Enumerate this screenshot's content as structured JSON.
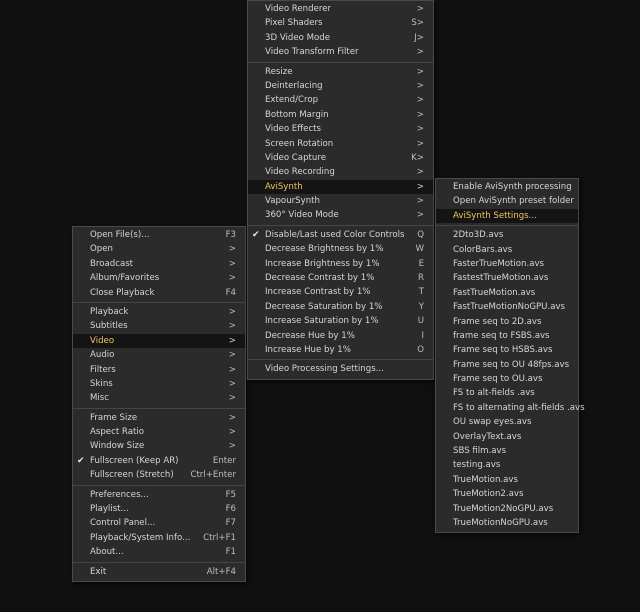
{
  "main_menu": {
    "items_a": [
      {
        "label": "Open File(s)...",
        "key": "F3"
      },
      {
        "label": "Open",
        "key": ">"
      },
      {
        "label": "Broadcast",
        "key": ">"
      },
      {
        "label": "Album/Favorites",
        "key": ">"
      },
      {
        "label": "Close Playback",
        "key": "F4"
      }
    ],
    "items_b": [
      {
        "label": "Playback",
        "key": ">"
      },
      {
        "label": "Subtitles",
        "key": ">"
      },
      {
        "label": "Video",
        "key": ">",
        "active": true
      },
      {
        "label": "Audio",
        "key": ">"
      },
      {
        "label": "Filters",
        "key": ">"
      },
      {
        "label": "Skins",
        "key": ">"
      },
      {
        "label": "Misc",
        "key": ">"
      }
    ],
    "items_c": [
      {
        "label": "Frame Size",
        "key": ">"
      },
      {
        "label": "Aspect Ratio",
        "key": ">"
      },
      {
        "label": "Window Size",
        "key": ">"
      },
      {
        "label": "Fullscreen (Keep AR)",
        "key": "Enter",
        "checked": true
      },
      {
        "label": "Fullscreen (Stretch)",
        "key": "Ctrl+Enter"
      }
    ],
    "items_d": [
      {
        "label": "Preferences...",
        "key": "F5"
      },
      {
        "label": "Playlist...",
        "key": "F6"
      },
      {
        "label": "Control Panel...",
        "key": "F7"
      },
      {
        "label": "Playback/System Info...",
        "key": "Ctrl+F1"
      },
      {
        "label": "About...",
        "key": "F1"
      }
    ],
    "items_e": [
      {
        "label": "Exit",
        "key": "Alt+F4"
      }
    ]
  },
  "video_menu": {
    "items_a": [
      {
        "label": "Video Renderer",
        "key": ">"
      },
      {
        "label": "Pixel Shaders",
        "key": "S>"
      },
      {
        "label": "3D Video Mode",
        "key": "J>"
      },
      {
        "label": "Video Transform Filter",
        "key": ">"
      }
    ],
    "items_b": [
      {
        "label": "Resize",
        "key": ">"
      },
      {
        "label": "Deinterlacing",
        "key": ">"
      },
      {
        "label": "Extend/Crop",
        "key": ">"
      },
      {
        "label": "Bottom Margin",
        "key": ">"
      },
      {
        "label": "Video Effects",
        "key": ">"
      },
      {
        "label": "Screen Rotation",
        "key": ">"
      },
      {
        "label": "Video Capture",
        "key": "K>"
      },
      {
        "label": "Video Recording",
        "key": ">"
      },
      {
        "label": "AviSynth",
        "key": ">",
        "active": true
      },
      {
        "label": "VapourSynth",
        "key": ">"
      },
      {
        "label": "360° Video Mode",
        "key": ">"
      }
    ],
    "items_c": [
      {
        "label": "Disable/Last used Color Controls",
        "key": "Q",
        "checked": true
      },
      {
        "label": "Decrease Brightness by 1%",
        "key": "W"
      },
      {
        "label": "Increase Brightness by 1%",
        "key": "E"
      },
      {
        "label": "Decrease Contrast by 1%",
        "key": "R"
      },
      {
        "label": "Increase Contrast by 1%",
        "key": "T"
      },
      {
        "label": "Decrease Saturation by 1%",
        "key": "Y"
      },
      {
        "label": "Increase Saturation by 1%",
        "key": "U"
      },
      {
        "label": "Decrease Hue by 1%",
        "key": "I"
      },
      {
        "label": "Increase Hue by 1%",
        "key": "O"
      }
    ],
    "items_d": [
      {
        "label": "Video Processing Settings...",
        "key": ""
      }
    ]
  },
  "avisynth_menu": {
    "items_a": [
      {
        "label": "Enable AviSynth processing",
        "key": ""
      },
      {
        "label": "Open AviSynth preset folder",
        "key": ""
      },
      {
        "label": "AviSynth Settings...",
        "key": "",
        "active": true
      }
    ],
    "items_b": [
      {
        "label": "2Dto3D.avs",
        "key": ""
      },
      {
        "label": "ColorBars.avs",
        "key": ""
      },
      {
        "label": "FasterTrueMotion.avs",
        "key": ""
      },
      {
        "label": "FastestTrueMotion.avs",
        "key": ""
      },
      {
        "label": "FastTrueMotion.avs",
        "key": ""
      },
      {
        "label": "FastTrueMotionNoGPU.avs",
        "key": ""
      },
      {
        "label": "Frame seq to 2D.avs",
        "key": ""
      },
      {
        "label": "frame seq to FSBS.avs",
        "key": ""
      },
      {
        "label": "Frame seq to HSBS.avs",
        "key": ""
      },
      {
        "label": "Frame seq to OU 48fps.avs",
        "key": ""
      },
      {
        "label": "Frame seq to OU.avs",
        "key": ""
      },
      {
        "label": "FS to alt-fields .avs",
        "key": ""
      },
      {
        "label": "FS to alternating alt-fields .avs",
        "key": ""
      },
      {
        "label": "OU swap eyes.avs",
        "key": ""
      },
      {
        "label": "OverlayText.avs",
        "key": ""
      },
      {
        "label": "SBS film.avs",
        "key": ""
      },
      {
        "label": "testing.avs",
        "key": ""
      },
      {
        "label": "TrueMotion.avs",
        "key": ""
      },
      {
        "label": "TrueMotion2.avs",
        "key": ""
      },
      {
        "label": "TrueMotion2NoGPU.avs",
        "key": ""
      },
      {
        "label": "TrueMotionNoGPU.avs",
        "key": ""
      }
    ]
  }
}
